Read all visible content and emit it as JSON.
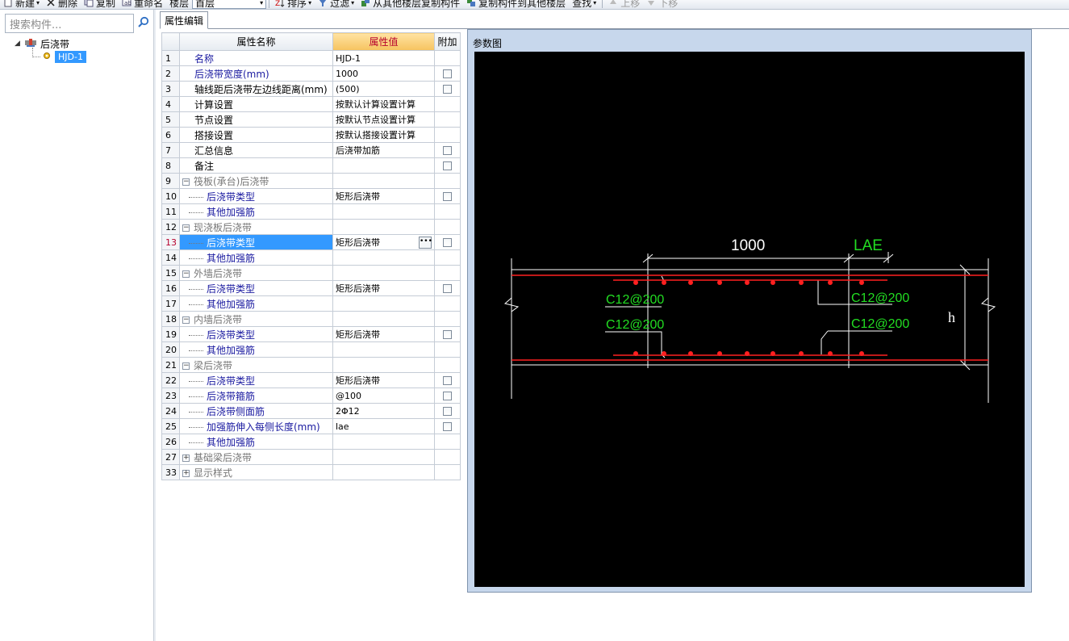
{
  "toolbar": {
    "items": [
      {
        "label": "新建",
        "dropdown": true
      },
      {
        "label": "删除"
      },
      {
        "label": "复制"
      },
      {
        "label": "重命名"
      },
      {
        "label": "楼层"
      },
      {
        "label": "首层"
      },
      {
        "label": "排序",
        "dropdown": true
      },
      {
        "label": "过滤",
        "dropdown": true
      },
      {
        "label": "从其他楼层复制构件"
      },
      {
        "label": "复制构件到其他楼层"
      },
      {
        "label": "查找",
        "dropdown": true
      },
      {
        "label": "上移"
      },
      {
        "label": "下移"
      }
    ]
  },
  "left_panel": {
    "search_placeholder": "搜索构件...",
    "tree": {
      "root_label": "后浇带",
      "child_label": "HJD-1"
    }
  },
  "tabs": [
    {
      "label": "属性编辑"
    }
  ],
  "grid": {
    "headers": {
      "name": "属性名称",
      "value": "属性值",
      "extra": "附加"
    },
    "rows": [
      {
        "num": "1",
        "name": "名称",
        "value": "HJD-1",
        "style": "blue",
        "indent": 0,
        "checkbox": false
      },
      {
        "num": "2",
        "name": "后浇带宽度(mm)",
        "value": "1000",
        "style": "blue",
        "indent": 0,
        "checkbox": true
      },
      {
        "num": "3",
        "name": "轴线距后浇带左边线距离(mm)",
        "value": "(500)",
        "style": "black",
        "indent": 0,
        "checkbox": true
      },
      {
        "num": "4",
        "name": "计算设置",
        "value": "按默认计算设置计算",
        "style": "black",
        "indent": 0,
        "checkbox": false
      },
      {
        "num": "5",
        "name": "节点设置",
        "value": "按默认节点设置计算",
        "style": "black",
        "indent": 0,
        "checkbox": false
      },
      {
        "num": "6",
        "name": "搭接设置",
        "value": "按默认搭接设置计算",
        "style": "black",
        "indent": 0,
        "checkbox": false
      },
      {
        "num": "7",
        "name": "汇总信息",
        "value": "后浇带加筋",
        "style": "black",
        "indent": 0,
        "checkbox": true
      },
      {
        "num": "8",
        "name": "备注",
        "value": "",
        "style": "black",
        "indent": 0,
        "checkbox": true
      },
      {
        "num": "9",
        "name": "筏板(承台)后浇带",
        "value": "",
        "style": "gray",
        "indent": 0,
        "group": "-",
        "checkbox": false
      },
      {
        "num": "10",
        "name": "后浇带类型",
        "value": "矩形后浇带",
        "style": "blue",
        "indent": 1,
        "checkbox": true
      },
      {
        "num": "11",
        "name": "其他加强筋",
        "value": "",
        "style": "blue",
        "indent": 1,
        "checkbox": false
      },
      {
        "num": "12",
        "name": "现浇板后浇带",
        "value": "",
        "style": "gray",
        "indent": 0,
        "group": "-",
        "checkbox": false
      },
      {
        "num": "13",
        "name": "后浇带类型",
        "value": "矩形后浇带",
        "style": "blue",
        "indent": 1,
        "checkbox": true,
        "selected": true
      },
      {
        "num": "14",
        "name": "其他加强筋",
        "value": "",
        "style": "blue",
        "indent": 1,
        "checkbox": false
      },
      {
        "num": "15",
        "name": "外墙后浇带",
        "value": "",
        "style": "gray",
        "indent": 0,
        "group": "-",
        "checkbox": false
      },
      {
        "num": "16",
        "name": "后浇带类型",
        "value": "矩形后浇带",
        "style": "blue",
        "indent": 1,
        "checkbox": true
      },
      {
        "num": "17",
        "name": "其他加强筋",
        "value": "",
        "style": "blue",
        "indent": 1,
        "checkbox": false
      },
      {
        "num": "18",
        "name": "内墙后浇带",
        "value": "",
        "style": "gray",
        "indent": 0,
        "group": "-",
        "checkbox": false
      },
      {
        "num": "19",
        "name": "后浇带类型",
        "value": "矩形后浇带",
        "style": "blue",
        "indent": 1,
        "checkbox": true
      },
      {
        "num": "20",
        "name": "其他加强筋",
        "value": "",
        "style": "blue",
        "indent": 1,
        "checkbox": false
      },
      {
        "num": "21",
        "name": "梁后浇带",
        "value": "",
        "style": "gray",
        "indent": 0,
        "group": "-",
        "checkbox": false
      },
      {
        "num": "22",
        "name": "后浇带类型",
        "value": "矩形后浇带",
        "style": "blue",
        "indent": 1,
        "checkbox": true
      },
      {
        "num": "23",
        "name": "后浇带箍筋",
        "value": "@100",
        "style": "blue",
        "indent": 1,
        "checkbox": true
      },
      {
        "num": "24",
        "name": "后浇带侧面筋",
        "value": "2Φ12",
        "style": "blue",
        "indent": 1,
        "checkbox": true
      },
      {
        "num": "25",
        "name": "加强筋伸入每侧长度(mm)",
        "value": "lae",
        "style": "blue",
        "indent": 1,
        "checkbox": true
      },
      {
        "num": "26",
        "name": "其他加强筋",
        "value": "",
        "style": "blue",
        "indent": 1,
        "checkbox": false
      },
      {
        "num": "27",
        "name": "基础梁后浇带",
        "value": "",
        "style": "gray",
        "indent": 0,
        "group": "+",
        "checkbox": false
      },
      {
        "num": "33",
        "name": "显示样式",
        "value": "",
        "style": "gray",
        "indent": 0,
        "group": "+",
        "checkbox": false
      }
    ]
  },
  "param_window": {
    "title": "参数图",
    "drawing": {
      "dim_width": "1000",
      "dim_lae": "LAE",
      "rebar_label_top_left": "C12@200",
      "rebar_label_top_right": "C12@200",
      "rebar_label_bottom_left": "C12@200",
      "rebar_label_bottom_right": "C12@200",
      "height_label": "h",
      "colors": {
        "background": "#000000",
        "rebar": "#ff2020",
        "text_green": "#22dd22",
        "lines": "#ffffff"
      }
    }
  }
}
